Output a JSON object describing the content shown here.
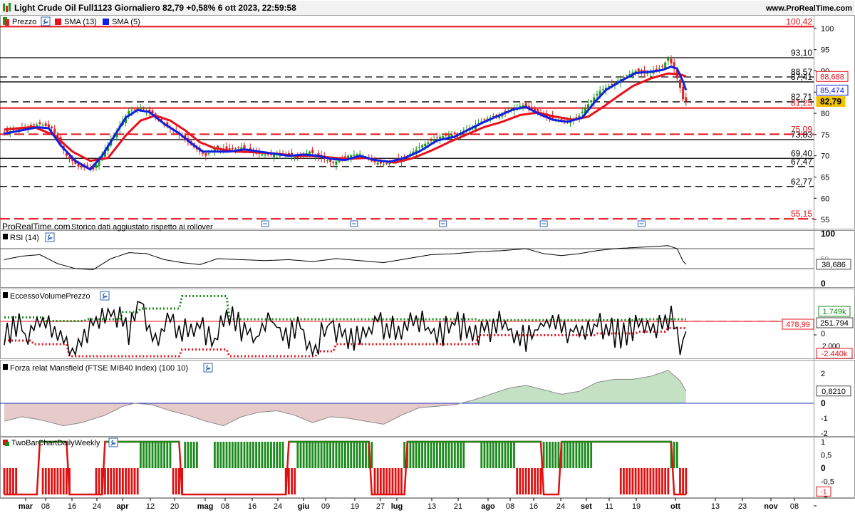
{
  "header": {
    "title": "Light Crude Oil Full1123 Giornaliero 82,79 +0,58% 6 ott 2023, 22:59:58",
    "site": "www.ProRealTime.com"
  },
  "colors": {
    "candle_up": "#1a9a1a",
    "candle_down": "#e02020",
    "sma13": "#e8101a",
    "sma5": "#1020e0",
    "line_black": "#000000",
    "line_red": "#e8101a",
    "mansfield_pos": "#3a9a3a",
    "mansfield_neg": "#b05050",
    "two_bar_green": "#1a8a1a",
    "two_bar_red": "#e01010",
    "ind_blue": "#2030c0"
  },
  "icons": [
    "wrench-icon",
    "color-swatch-icon",
    "calendar-event-icon"
  ],
  "price_pane": {
    "legend": {
      "prezzo": "Prezzo",
      "sma13": "SMA (13)",
      "sma5": "SMA (5)"
    },
    "watermark": "ProRealTime.com",
    "note": "Storico dati aggiustato rispetto ai rollover",
    "ylim": [
      53,
      103
    ]
  },
  "price_axis_ticks": [
    "100",
    "95",
    "90",
    "85",
    "80",
    "75",
    "70",
    "65",
    "60",
    "55"
  ],
  "hlines": [
    {
      "value": 100.42,
      "label": "100,42",
      "color": "#e8101a",
      "style": "solid",
      "label_color": "#e8101a"
    },
    {
      "value": 93.1,
      "label": "93,10",
      "color": "#000000",
      "style": "solid",
      "label_color": "#000000"
    },
    {
      "value": 88.57,
      "label": "88,57",
      "color": "#000000",
      "style": "dashed",
      "label_color": "#000000"
    },
    {
      "value": 87.41,
      "label": "87,41",
      "color": "#000000",
      "style": "solid",
      "label_color": "#000000"
    },
    {
      "value": 82.71,
      "label": "82,71",
      "color": "#000000",
      "style": "dashed",
      "label_color": "#000000"
    },
    {
      "value": 81.25,
      "label": "81,25",
      "color": "#e8101a",
      "style": "solid",
      "label_color": "#e8101a"
    },
    {
      "value": 75.09,
      "label": "75,09",
      "color": "#e8101a",
      "style": "dashed",
      "label_color": "#e8101a"
    },
    {
      "value": 73.83,
      "label": "73,83",
      "color": "#000000",
      "style": "solid",
      "label_color": "#000000"
    },
    {
      "value": 69.4,
      "label": "69,40",
      "color": "#000000",
      "style": "solid",
      "label_color": "#000000"
    },
    {
      "value": 67.47,
      "label": "67,47",
      "color": "#000000",
      "style": "dashed",
      "label_color": "#000000"
    },
    {
      "value": 62.77,
      "label": "62,77",
      "color": "#000000",
      "style": "dashed",
      "label_color": "#000000"
    },
    {
      "value": 55.15,
      "label": "55,15",
      "color": "#e8101a",
      "style": "dashed",
      "label_color": "#e8101a"
    }
  ],
  "price_badges": [
    {
      "value": 88.688,
      "label": "88,688",
      "style": "red"
    },
    {
      "value": 85.474,
      "label": "85,474",
      "style": "blue"
    },
    {
      "value": 82.79,
      "label": "82,79",
      "style": "last"
    }
  ],
  "chart_data": {
    "type": "candlestick",
    "title": "Light Crude Oil Full1123 Giornaliero",
    "legend_placement": "top-left",
    "x_ticks": [
      "mar",
      "08",
      "16",
      "24",
      "apr",
      "12",
      "20",
      "mag",
      "08",
      "16",
      "24",
      "giu",
      "09",
      "19",
      "27",
      "lug",
      "13",
      "21",
      "ago",
      "08",
      "16",
      "24",
      "set",
      "11",
      "19",
      "ott",
      "13",
      "23",
      "nov",
      "08"
    ],
    "close_anchors": [
      [
        0,
        75.5
      ],
      [
        12,
        77.5
      ],
      [
        16,
        76.5
      ],
      [
        21,
        70.0
      ],
      [
        25,
        67.5
      ],
      [
        30,
        66.8
      ],
      [
        36,
        73.8
      ],
      [
        42,
        80.5
      ],
      [
        46,
        81.3
      ],
      [
        50,
        80.0
      ],
      [
        55,
        77.0
      ],
      [
        60,
        74.5
      ],
      [
        64,
        72.0
      ],
      [
        68,
        70.0
      ],
      [
        71,
        71.8
      ],
      [
        76,
        71.5
      ],
      [
        80,
        72.0
      ],
      [
        85,
        70.5
      ],
      [
        90,
        70.2
      ],
      [
        94,
        70.5
      ],
      [
        99,
        69.5
      ],
      [
        103,
        71.0
      ],
      [
        107,
        69.5
      ],
      [
        111,
        68.3
      ],
      [
        116,
        70.0
      ],
      [
        120,
        70.5
      ],
      [
        124,
        68.7
      ],
      [
        128,
        68.0
      ],
      [
        132,
        69.0
      ],
      [
        136,
        70.0
      ],
      [
        141,
        72.5
      ],
      [
        147,
        74.5
      ],
      [
        153,
        75.2
      ],
      [
        158,
        76.8
      ],
      [
        162,
        78.5
      ],
      [
        166,
        79.5
      ],
      [
        170,
        80.5
      ],
      [
        175,
        82.0
      ],
      [
        178,
        81.0
      ],
      [
        182,
        79.5
      ],
      [
        186,
        78.5
      ],
      [
        190,
        78.0
      ],
      [
        194,
        79.5
      ],
      [
        198,
        83.0
      ],
      [
        201,
        85.3
      ],
      [
        205,
        86.8
      ],
      [
        209,
        88.5
      ],
      [
        213,
        90.0
      ],
      [
        216,
        89.5
      ],
      [
        219,
        90.0
      ],
      [
        222,
        91.0
      ],
      [
        224,
        93.0
      ],
      [
        226,
        90.5
      ],
      [
        228,
        86.0
      ],
      [
        229,
        83.3
      ],
      [
        230,
        82.79
      ]
    ],
    "sma13_anchors": [
      [
        0,
        76.2
      ],
      [
        10,
        76.8
      ],
      [
        17,
        74.8
      ],
      [
        23,
        71.0
      ],
      [
        29,
        68.8
      ],
      [
        35,
        69.5
      ],
      [
        41,
        74.8
      ],
      [
        46,
        78.3
      ],
      [
        51,
        79.5
      ],
      [
        56,
        78.3
      ],
      [
        61,
        76.0
      ],
      [
        66,
        73.2
      ],
      [
        71,
        71.8
      ],
      [
        78,
        71.0
      ],
      [
        86,
        70.8
      ],
      [
        92,
        70.5
      ],
      [
        98,
        70.0
      ],
      [
        104,
        70.0
      ],
      [
        110,
        69.6
      ],
      [
        116,
        69.3
      ],
      [
        122,
        69.5
      ],
      [
        127,
        68.8
      ],
      [
        132,
        68.4
      ],
      [
        138,
        69.5
      ],
      [
        144,
        71.2
      ],
      [
        150,
        73.2
      ],
      [
        156,
        75.0
      ],
      [
        162,
        76.8
      ],
      [
        168,
        78.0
      ],
      [
        174,
        79.6
      ],
      [
        180,
        80.2
      ],
      [
        186,
        79.2
      ],
      [
        192,
        78.5
      ],
      [
        197,
        79.2
      ],
      [
        202,
        81.5
      ],
      [
        207,
        84.0
      ],
      [
        212,
        86.4
      ],
      [
        218,
        88.2
      ],
      [
        224,
        89.4
      ],
      [
        228,
        89.2
      ],
      [
        230,
        88.688
      ]
    ],
    "sma5_anchors": [
      [
        0,
        75.2
      ],
      [
        11,
        76.7
      ],
      [
        15,
        76.5
      ],
      [
        19,
        72.5
      ],
      [
        24,
        68.8
      ],
      [
        29,
        66.8
      ],
      [
        33,
        70.0
      ],
      [
        37,
        74.5
      ],
      [
        41,
        79.0
      ],
      [
        45,
        80.8
      ],
      [
        49,
        80.3
      ],
      [
        54,
        77.5
      ],
      [
        59,
        75.3
      ],
      [
        63,
        73.0
      ],
      [
        67,
        71.0
      ],
      [
        71,
        71.0
      ],
      [
        76,
        71.0
      ],
      [
        81,
        71.5
      ],
      [
        86,
        71.0
      ],
      [
        91,
        70.5
      ],
      [
        96,
        70.0
      ],
      [
        101,
        70.3
      ],
      [
        106,
        70.0
      ],
      [
        110,
        69.3
      ],
      [
        115,
        69.0
      ],
      [
        120,
        70.0
      ],
      [
        125,
        69.0
      ],
      [
        130,
        68.6
      ],
      [
        135,
        69.5
      ],
      [
        140,
        71.0
      ],
      [
        146,
        73.6
      ],
      [
        152,
        74.5
      ],
      [
        157,
        76.3
      ],
      [
        162,
        78.0
      ],
      [
        167,
        79.5
      ],
      [
        172,
        81.0
      ],
      [
        176,
        81.5
      ],
      [
        180,
        80.0
      ],
      [
        185,
        78.5
      ],
      [
        190,
        78.0
      ],
      [
        195,
        79.0
      ],
      [
        199,
        82.5
      ],
      [
        203,
        85.5
      ],
      [
        208,
        87.6
      ],
      [
        213,
        89.5
      ],
      [
        218,
        89.8
      ],
      [
        222,
        90.2
      ],
      [
        225,
        91.0
      ],
      [
        227,
        90.5
      ],
      [
        229,
        87.5
      ],
      [
        230,
        85.474
      ]
    ]
  },
  "rsi": {
    "label": "RSI (14)",
    "ticks": [
      "100",
      "50",
      "0"
    ],
    "last_label": "38,686",
    "anchors": [
      [
        0,
        48
      ],
      [
        6,
        55
      ],
      [
        12,
        58
      ],
      [
        18,
        40
      ],
      [
        24,
        30
      ],
      [
        30,
        28
      ],
      [
        36,
        50
      ],
      [
        42,
        62
      ],
      [
        48,
        60
      ],
      [
        54,
        48
      ],
      [
        60,
        42
      ],
      [
        66,
        38
      ],
      [
        72,
        50
      ],
      [
        80,
        48
      ],
      [
        88,
        46
      ],
      [
        96,
        48
      ],
      [
        104,
        44
      ],
      [
        112,
        50
      ],
      [
        120,
        46
      ],
      [
        128,
        42
      ],
      [
        136,
        50
      ],
      [
        144,
        58
      ],
      [
        152,
        60
      ],
      [
        160,
        64
      ],
      [
        168,
        66
      ],
      [
        176,
        70
      ],
      [
        182,
        60
      ],
      [
        188,
        56
      ],
      [
        194,
        60
      ],
      [
        200,
        66
      ],
      [
        206,
        70
      ],
      [
        212,
        72
      ],
      [
        218,
        74
      ],
      [
        224,
        76
      ],
      [
        227,
        70
      ],
      [
        229,
        45
      ],
      [
        230,
        38.686
      ]
    ]
  },
  "eccesso": {
    "label": "EccessoVolumePrezzo",
    "labels": {
      "top": "1.749k",
      "mid": "478,99",
      "last": "251.794",
      "zero": "0",
      "low": "-2.440k",
      "partial": "2.000"
    },
    "upper_steps": [
      [
        0,
        0.7
      ],
      [
        14,
        0.5
      ],
      [
        28,
        0.6
      ],
      [
        40,
        1.0
      ],
      [
        46,
        1.2
      ],
      [
        60,
        1.9
      ],
      [
        74,
        1.9
      ],
      [
        76,
        0.6
      ],
      [
        160,
        0.55
      ],
      [
        214,
        0.6
      ],
      [
        230,
        1.749
      ]
    ],
    "lower_steps": [
      [
        0,
        -0.6
      ],
      [
        10,
        -0.8
      ],
      [
        22,
        -1.5
      ],
      [
        60,
        -1.1
      ],
      [
        76,
        -1.6
      ],
      [
        106,
        -1.2
      ],
      [
        112,
        -0.8
      ],
      [
        160,
        -0.3
      ],
      [
        200,
        -0.2
      ],
      [
        214,
        -0.1
      ],
      [
        224,
        0.1
      ],
      [
        230,
        -2.44
      ]
    ],
    "oscillator_anchors": [
      [
        0,
        -0.2
      ],
      [
        4,
        0.3
      ],
      [
        8,
        -0.4
      ],
      [
        14,
        0.8
      ],
      [
        20,
        -0.6
      ],
      [
        24,
        -1.2
      ],
      [
        30,
        0.4
      ],
      [
        36,
        1.0
      ],
      [
        42,
        0.0
      ],
      [
        46,
        2.0
      ],
      [
        50,
        -0.4
      ],
      [
        56,
        0.5
      ],
      [
        62,
        -0.3
      ],
      [
        66,
        0.6
      ],
      [
        70,
        -0.8
      ],
      [
        76,
        0.9
      ],
      [
        84,
        -0.6
      ],
      [
        90,
        0.5
      ],
      [
        96,
        -0.4
      ],
      [
        100,
        0.3
      ],
      [
        104,
        -1.2
      ],
      [
        110,
        0.4
      ],
      [
        118,
        -0.8
      ],
      [
        126,
        0.5
      ],
      [
        132,
        -0.2
      ],
      [
        138,
        0.8
      ],
      [
        146,
        -0.5
      ],
      [
        152,
        0.4
      ],
      [
        160,
        -0.2
      ],
      [
        168,
        0.3
      ],
      [
        176,
        -0.4
      ],
      [
        184,
        0.6
      ],
      [
        190,
        -0.2
      ],
      [
        198,
        0.4
      ],
      [
        206,
        -0.3
      ],
      [
        214,
        0.2
      ],
      [
        220,
        -0.2
      ],
      [
        226,
        0.9
      ],
      [
        228,
        -2.2
      ],
      [
        230,
        0.251
      ]
    ]
  },
  "mansfield": {
    "label": "Forza relat Mansfield (FTSE MIB40 Index) (100 10)",
    "ticks": [
      "2",
      "1",
      "0",
      "-1",
      "-2"
    ],
    "last_label": "0,8210",
    "anchors": [
      [
        0,
        -1.2
      ],
      [
        6,
        -0.9
      ],
      [
        12,
        -1.1
      ],
      [
        20,
        -1.5
      ],
      [
        26,
        -1.3
      ],
      [
        34,
        -0.8
      ],
      [
        40,
        -0.2
      ],
      [
        44,
        0.0
      ],
      [
        50,
        -0.1
      ],
      [
        56,
        -0.5
      ],
      [
        62,
        -0.8
      ],
      [
        68,
        -1.2
      ],
      [
        74,
        -1.5
      ],
      [
        80,
        -0.9
      ],
      [
        86,
        -0.6
      ],
      [
        92,
        -0.5
      ],
      [
        98,
        -0.8
      ],
      [
        104,
        -1.3
      ],
      [
        110,
        -0.9
      ],
      [
        116,
        -1.0
      ],
      [
        122,
        -1.2
      ],
      [
        128,
        -1.4
      ],
      [
        134,
        -0.8
      ],
      [
        140,
        -0.3
      ],
      [
        146,
        -0.2
      ],
      [
        152,
        -0.1
      ],
      [
        158,
        0.2
      ],
      [
        164,
        0.6
      ],
      [
        170,
        1.0
      ],
      [
        176,
        1.2
      ],
      [
        182,
        0.9
      ],
      [
        188,
        0.6
      ],
      [
        194,
        0.8
      ],
      [
        200,
        1.4
      ],
      [
        206,
        1.6
      ],
      [
        212,
        1.6
      ],
      [
        218,
        1.8
      ],
      [
        224,
        2.2
      ],
      [
        228,
        1.5
      ],
      [
        230,
        0.821
      ]
    ]
  },
  "two_bar": {
    "label": "TwoBarChartDailyWeekly",
    "ticks": [
      "1",
      "0,5",
      "0",
      "-0,5",
      "-1"
    ],
    "last_label": "-1",
    "segments": [
      [
        0,
        4,
        -1
      ],
      [
        5,
        12,
        0
      ],
      [
        13,
        22,
        -1
      ],
      [
        23,
        30,
        0
      ],
      [
        31,
        45,
        -1
      ],
      [
        46,
        56,
        1
      ],
      [
        57,
        60,
        -1
      ],
      [
        61,
        65,
        1
      ],
      [
        66,
        70,
        0
      ],
      [
        71,
        94,
        1
      ],
      [
        95,
        98,
        -1
      ],
      [
        99,
        124,
        1
      ],
      [
        125,
        134,
        -1
      ],
      [
        135,
        155,
        1
      ],
      [
        156,
        160,
        0
      ],
      [
        161,
        172,
        1
      ],
      [
        173,
        181,
        -1
      ],
      [
        182,
        198,
        1
      ],
      [
        199,
        207,
        0
      ],
      [
        208,
        224,
        -1
      ],
      [
        225,
        227,
        1
      ],
      [
        228,
        230,
        -1
      ]
    ],
    "weekly_steps": [
      [
        0,
        -1
      ],
      [
        12,
        1
      ],
      [
        22,
        -1
      ],
      [
        34,
        1
      ],
      [
        60,
        -1
      ],
      [
        96,
        1
      ],
      [
        124,
        -1
      ],
      [
        136,
        1
      ],
      [
        182,
        -1
      ],
      [
        188,
        1
      ],
      [
        226,
        -1
      ],
      [
        230,
        -1
      ]
    ]
  }
}
